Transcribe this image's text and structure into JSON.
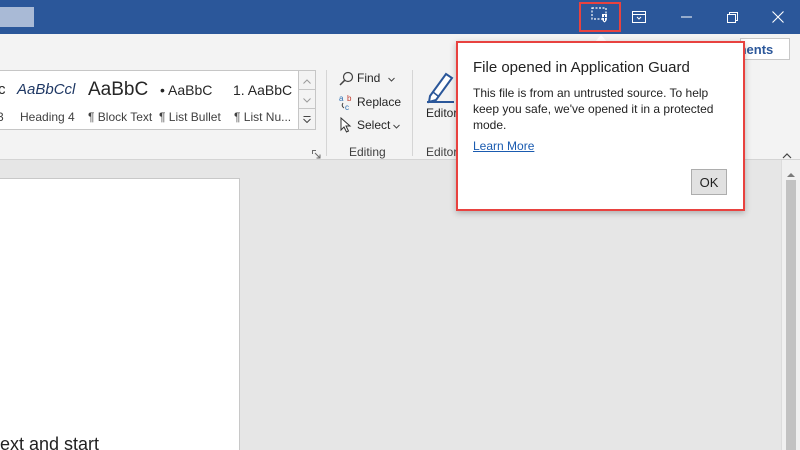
{
  "titlebar": {
    "bg_color": "#2b579a",
    "app_guard_icon": "application-guard-icon",
    "buttons": [
      {
        "name": "ribbon-display-options",
        "icon": "ribbon-display-icon"
      },
      {
        "name": "minimize",
        "icon": "minimize-icon"
      },
      {
        "name": "restore",
        "icon": "restore-icon"
      },
      {
        "name": "close",
        "icon": "close-icon"
      }
    ]
  },
  "ribbon": {
    "comments_label": "ments",
    "styles": [
      {
        "preview": "c",
        "label": "3"
      },
      {
        "preview": "AaBbCcl",
        "label": "Heading 4"
      },
      {
        "preview": "AaBbC",
        "label": "¶ Block Text"
      },
      {
        "preview": "• AaBbC",
        "label": "¶ List Bullet"
      },
      {
        "preview": "1. AaBbC",
        "label": "¶ List Nu..."
      }
    ],
    "editing": {
      "find": "Find",
      "replace": "Replace",
      "select": "Select",
      "group_label": "Editing"
    },
    "editor": {
      "button_label": "Editor",
      "group_label": "Editor"
    }
  },
  "document": {
    "visible_text": "ext and start"
  },
  "callout": {
    "title": "File opened in Application Guard",
    "body": "This file is from an untrusted source. To help keep you safe, we've opened it in a protected mode.",
    "link": "Learn More",
    "ok_label": "OK",
    "highlight_color": "#e8423f"
  }
}
